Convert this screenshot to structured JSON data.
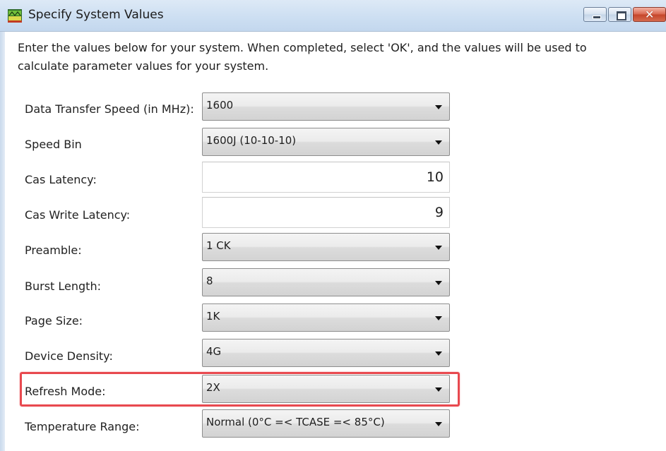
{
  "window": {
    "title": "Specify System Values",
    "icon": "chip-icon",
    "controls": {
      "minimize": "minimize-icon",
      "maximize": "maximize-icon",
      "close": "close-icon",
      "close_glyph": "✕"
    }
  },
  "intro": "Enter the values below for your system. When completed, select 'OK', and the values will be used to calculate parameter values for your system.",
  "fields": {
    "data_transfer_speed": {
      "label": "Data Transfer Speed (in MHz):",
      "value": "1600"
    },
    "speed_bin": {
      "label": "Speed Bin",
      "value": "1600J (10-10-10)"
    },
    "cas_latency": {
      "label": "Cas Latency:",
      "value": "10"
    },
    "cas_write_latency": {
      "label": "Cas Write Latency:",
      "value": "9"
    },
    "preamble": {
      "label": "Preamble:",
      "value": "1 CK"
    },
    "burst_length": {
      "label": "Burst Length:",
      "value": "8"
    },
    "page_size": {
      "label": "Page Size:",
      "value": "1K"
    },
    "device_density": {
      "label": "Device Density:",
      "value": "4G"
    },
    "refresh_mode": {
      "label": "Refresh Mode:",
      "value": "2X",
      "highlighted": true
    },
    "temperature_range": {
      "label": "Temperature Range:",
      "value": "Normal (0°C =< TCASE =< 85°C)"
    }
  },
  "colors": {
    "highlight": "#e8494f",
    "titlebar": "#cddff2"
  }
}
